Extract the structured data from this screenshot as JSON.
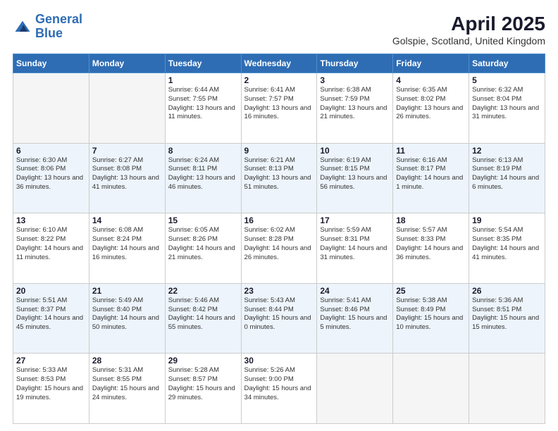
{
  "header": {
    "logo_line1": "General",
    "logo_line2": "Blue",
    "title": "April 2025",
    "subtitle": "Golspie, Scotland, United Kingdom"
  },
  "weekdays": [
    "Sunday",
    "Monday",
    "Tuesday",
    "Wednesday",
    "Thursday",
    "Friday",
    "Saturday"
  ],
  "weeks": [
    [
      {
        "num": "",
        "info": ""
      },
      {
        "num": "",
        "info": ""
      },
      {
        "num": "1",
        "info": "Sunrise: 6:44 AM\nSunset: 7:55 PM\nDaylight: 13 hours and 11 minutes."
      },
      {
        "num": "2",
        "info": "Sunrise: 6:41 AM\nSunset: 7:57 PM\nDaylight: 13 hours and 16 minutes."
      },
      {
        "num": "3",
        "info": "Sunrise: 6:38 AM\nSunset: 7:59 PM\nDaylight: 13 hours and 21 minutes."
      },
      {
        "num": "4",
        "info": "Sunrise: 6:35 AM\nSunset: 8:02 PM\nDaylight: 13 hours and 26 minutes."
      },
      {
        "num": "5",
        "info": "Sunrise: 6:32 AM\nSunset: 8:04 PM\nDaylight: 13 hours and 31 minutes."
      }
    ],
    [
      {
        "num": "6",
        "info": "Sunrise: 6:30 AM\nSunset: 8:06 PM\nDaylight: 13 hours and 36 minutes."
      },
      {
        "num": "7",
        "info": "Sunrise: 6:27 AM\nSunset: 8:08 PM\nDaylight: 13 hours and 41 minutes."
      },
      {
        "num": "8",
        "info": "Sunrise: 6:24 AM\nSunset: 8:11 PM\nDaylight: 13 hours and 46 minutes."
      },
      {
        "num": "9",
        "info": "Sunrise: 6:21 AM\nSunset: 8:13 PM\nDaylight: 13 hours and 51 minutes."
      },
      {
        "num": "10",
        "info": "Sunrise: 6:19 AM\nSunset: 8:15 PM\nDaylight: 13 hours and 56 minutes."
      },
      {
        "num": "11",
        "info": "Sunrise: 6:16 AM\nSunset: 8:17 PM\nDaylight: 14 hours and 1 minute."
      },
      {
        "num": "12",
        "info": "Sunrise: 6:13 AM\nSunset: 8:19 PM\nDaylight: 14 hours and 6 minutes."
      }
    ],
    [
      {
        "num": "13",
        "info": "Sunrise: 6:10 AM\nSunset: 8:22 PM\nDaylight: 14 hours and 11 minutes."
      },
      {
        "num": "14",
        "info": "Sunrise: 6:08 AM\nSunset: 8:24 PM\nDaylight: 14 hours and 16 minutes."
      },
      {
        "num": "15",
        "info": "Sunrise: 6:05 AM\nSunset: 8:26 PM\nDaylight: 14 hours and 21 minutes."
      },
      {
        "num": "16",
        "info": "Sunrise: 6:02 AM\nSunset: 8:28 PM\nDaylight: 14 hours and 26 minutes."
      },
      {
        "num": "17",
        "info": "Sunrise: 5:59 AM\nSunset: 8:31 PM\nDaylight: 14 hours and 31 minutes."
      },
      {
        "num": "18",
        "info": "Sunrise: 5:57 AM\nSunset: 8:33 PM\nDaylight: 14 hours and 36 minutes."
      },
      {
        "num": "19",
        "info": "Sunrise: 5:54 AM\nSunset: 8:35 PM\nDaylight: 14 hours and 41 minutes."
      }
    ],
    [
      {
        "num": "20",
        "info": "Sunrise: 5:51 AM\nSunset: 8:37 PM\nDaylight: 14 hours and 45 minutes."
      },
      {
        "num": "21",
        "info": "Sunrise: 5:49 AM\nSunset: 8:40 PM\nDaylight: 14 hours and 50 minutes."
      },
      {
        "num": "22",
        "info": "Sunrise: 5:46 AM\nSunset: 8:42 PM\nDaylight: 14 hours and 55 minutes."
      },
      {
        "num": "23",
        "info": "Sunrise: 5:43 AM\nSunset: 8:44 PM\nDaylight: 15 hours and 0 minutes."
      },
      {
        "num": "24",
        "info": "Sunrise: 5:41 AM\nSunset: 8:46 PM\nDaylight: 15 hours and 5 minutes."
      },
      {
        "num": "25",
        "info": "Sunrise: 5:38 AM\nSunset: 8:49 PM\nDaylight: 15 hours and 10 minutes."
      },
      {
        "num": "26",
        "info": "Sunrise: 5:36 AM\nSunset: 8:51 PM\nDaylight: 15 hours and 15 minutes."
      }
    ],
    [
      {
        "num": "27",
        "info": "Sunrise: 5:33 AM\nSunset: 8:53 PM\nDaylight: 15 hours and 19 minutes."
      },
      {
        "num": "28",
        "info": "Sunrise: 5:31 AM\nSunset: 8:55 PM\nDaylight: 15 hours and 24 minutes."
      },
      {
        "num": "29",
        "info": "Sunrise: 5:28 AM\nSunset: 8:57 PM\nDaylight: 15 hours and 29 minutes."
      },
      {
        "num": "30",
        "info": "Sunrise: 5:26 AM\nSunset: 9:00 PM\nDaylight: 15 hours and 34 minutes."
      },
      {
        "num": "",
        "info": ""
      },
      {
        "num": "",
        "info": ""
      },
      {
        "num": "",
        "info": ""
      }
    ]
  ]
}
